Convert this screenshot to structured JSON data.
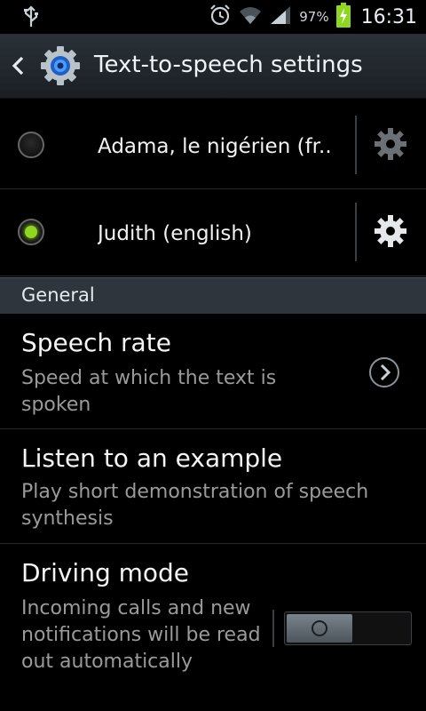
{
  "status_bar": {
    "battery_percent": "97%",
    "time": "16:31",
    "icons": [
      "usb-icon",
      "alarm-icon",
      "wifi-icon",
      "signal-icon",
      "battery-charging-icon"
    ]
  },
  "header": {
    "title": "Text-to-speech settings",
    "back_icon": "back-arrow-icon",
    "app_icon": "settings-gear-icon"
  },
  "voices": [
    {
      "label": "Adama, le nigérien (fr..",
      "selected": false
    },
    {
      "label": "Judith (english)",
      "selected": true
    }
  ],
  "section": {
    "title": "General"
  },
  "settings": {
    "speech_rate": {
      "title": "Speech rate",
      "summary": "Speed at which the text is spoken"
    },
    "listen_example": {
      "title": "Listen to an example",
      "summary": "Play short demonstration of speech synthesis"
    },
    "driving_mode": {
      "title": "Driving mode",
      "summary": "Incoming calls and new notifications will be read out automatically",
      "enabled": false
    }
  },
  "colors": {
    "accent": "#8fd620",
    "header_bg": "#2a3138",
    "summary_text": "#9a9a9a"
  }
}
